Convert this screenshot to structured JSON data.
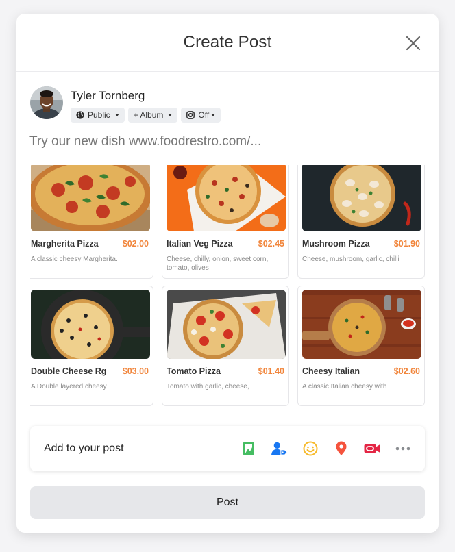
{
  "modal": {
    "title": "Create Post"
  },
  "author": {
    "name": "Tyler Tornberg",
    "chips": {
      "audience": "Public",
      "album": "+ Album",
      "instagram": "Off"
    }
  },
  "post": {
    "text": "Try our new dish www.foodrestro.com/..."
  },
  "menu": {
    "items": [
      {
        "name": "Margherita Pizza",
        "price": "$02.00",
        "desc": "A classic cheesy Margherita."
      },
      {
        "name": "Italian Veg Pizza",
        "price": "$02.45",
        "desc": "Cheese, chilly, onion, sweet corn, tomato, olives"
      },
      {
        "name": "Mushroom Pizza",
        "price": "$01.90",
        "desc": "Cheese, mushroom, garlic, chilli"
      },
      {
        "name": "Double Cheese Rg",
        "price": "$03.00",
        "desc": "A Double layered cheesy"
      },
      {
        "name": "Tomato Pizza",
        "price": "$01.40",
        "desc": "Tomato with garlic, cheese,"
      },
      {
        "name": "Cheesy Italian",
        "price": "$02.60",
        "desc": "A classic Italian cheesy with"
      }
    ]
  },
  "add_to_post": {
    "label": "Add to your post",
    "icons": [
      "photo-icon",
      "tag-people-icon",
      "feeling-icon",
      "location-icon",
      "live-video-icon",
      "more-icon"
    ]
  },
  "post_button": {
    "label": "Post"
  },
  "colors": {
    "price": "#f1853b",
    "photo": "#45bd62",
    "tag": "#1877f2",
    "feeling": "#f7b928",
    "location": "#f5533d",
    "video": "#e42645",
    "more": "#8a8d91"
  }
}
